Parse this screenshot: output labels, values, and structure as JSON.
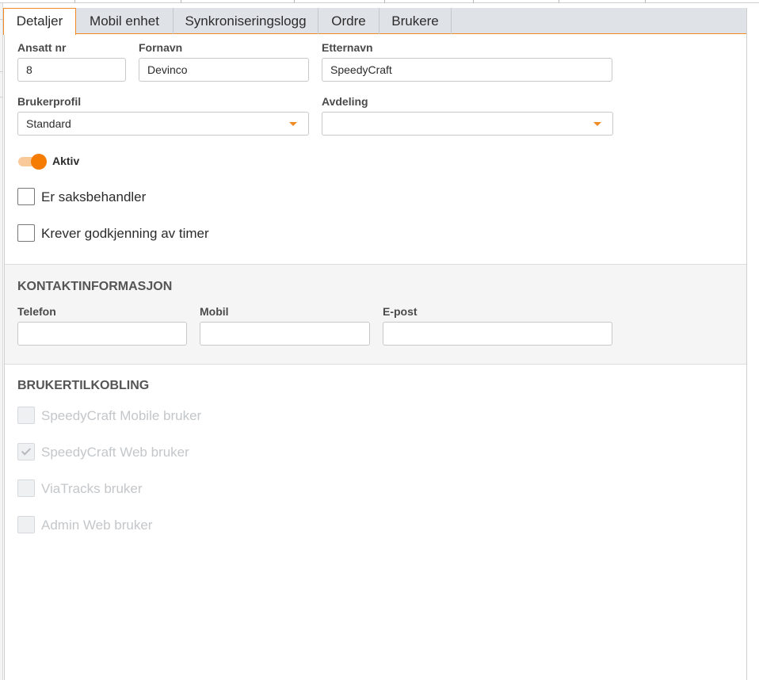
{
  "tabs": [
    {
      "label": "Detaljer",
      "active": true
    },
    {
      "label": "Mobil enhet",
      "active": false
    },
    {
      "label": "Synkroniseringslogg",
      "active": false
    },
    {
      "label": "Ordre",
      "active": false
    },
    {
      "label": "Brukere",
      "active": false
    }
  ],
  "details": {
    "employee_no_label": "Ansatt nr",
    "employee_no_value": "8",
    "first_name_label": "Fornavn",
    "first_name_value": "Devinco",
    "last_name_label": "Etternavn",
    "last_name_value": "SpeedyCraft",
    "profile_label": "Brukerprofil",
    "profile_value": "Standard",
    "department_label": "Avdeling",
    "department_value": "",
    "active_label": "Aktiv",
    "active_on": true,
    "caseworker_label": "Er saksbehandler",
    "caseworker_checked": false,
    "approval_label": "Krever godkjenning av timer",
    "approval_checked": false
  },
  "contact": {
    "title": "KONTAKTINFORMASJON",
    "phone_label": "Telefon",
    "phone_value": "",
    "mobile_label": "Mobil",
    "mobile_value": "",
    "email_label": "E-post",
    "email_value": ""
  },
  "connection": {
    "title": "BRUKERTILKOBLING",
    "items": [
      {
        "label": "SpeedyCraft Mobile bruker",
        "checked": false
      },
      {
        "label": "SpeedyCraft Web bruker",
        "checked": true
      },
      {
        "label": "ViaTracks bruker",
        "checked": false
      },
      {
        "label": "Admin Web bruker",
        "checked": false
      }
    ]
  },
  "colors": {
    "accent": "#f57c00",
    "tabbar": "#dfe3e8"
  },
  "icons": {
    "dropdown": "chevron-down-icon",
    "check": "check-icon"
  }
}
